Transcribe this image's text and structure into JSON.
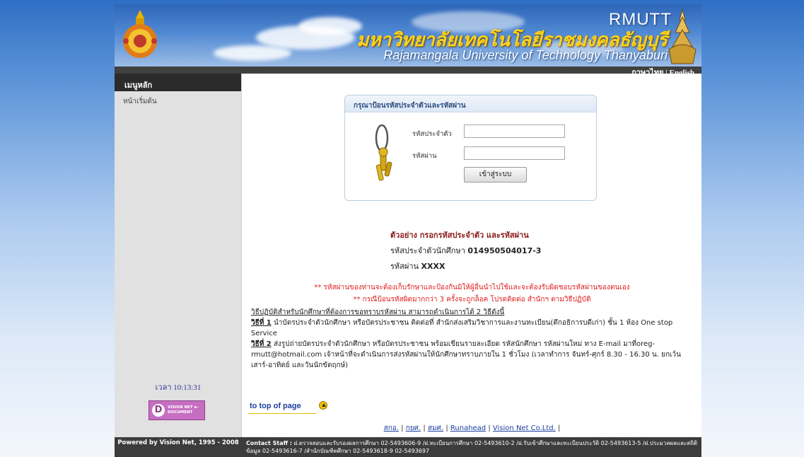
{
  "banner": {
    "brand": "RMUTT",
    "thai_name": "มหาวิทยาลัยเทคโนโลยีราชมงคลธัญบุรี",
    "english_name": "Rajamangala University of Technology Thanyaburi"
  },
  "language_links": {
    "thai": "ภาษาไทย",
    "separator": "|",
    "english": "English"
  },
  "sidebar": {
    "menu_header": "เมนูหลัก",
    "home_item": "หน้าเริ่มต้น",
    "clock": "เวลา 10:13:31",
    "vision_logo_text": "VISION NET e-DOCUMENT"
  },
  "login": {
    "title": "กรุณาป้อนรหัสประจำตัวและรหัสผ่าน",
    "id_label": "รหัสประจำตัว",
    "password_label": "รหัสผ่าน",
    "id_value": "",
    "password_value": "",
    "submit_label": "เข้าสู่ระบบ"
  },
  "example": {
    "title": "ตัวอย่าง กรอกรหัสประจำตัว และรหัสผ่าน",
    "id_prefix": "รหัสประจำตัวนักศึกษา",
    "id_value": "014950504017-3",
    "password_prefix": "รหัสผ่าน",
    "password_value": "XXXX"
  },
  "warnings": {
    "line1": "** รหัสผ่านของท่านจะต้องเก็บรักษาและป้องกันมิให้ผู้อื่นนำไปใช้และจะต้องรับผิดชอบรหัสผ่านของตนเอง",
    "line2": "** กรณีป้อนรหัสผิดมากกว่า 3 ครั้งจะถูกล็อค โปรดติดต่อ สำนักฯ ตามวิธีปฏิบัติ"
  },
  "howto": {
    "heading": "วิธีปฏิบัติสำหรับนักศึกษาที่ต้องการขอทราบรหัสผ่าน สามารถดำเนินการได้ 2 วิธีดังนี้",
    "method1_label": "วิธีที่ 1",
    "method1_text": "นำบัตรประจำตัวนักศึกษา หรือบัตรประชาชน ติดต่อที่ สำนักส่งเสริมวิชาการและงานทะเบียน(ตึกอธิการบดีเก่า) ชั้น 1 ห้อง One stop Service",
    "method2_label": "วิธีที่ 2",
    "method2_text": "ส่งรูปถ่ายบัตรประจำตัวนักศึกษา หรือบัตรประชาชน พร้อมเขียนรายละเอียด รหัสนักศึกษา รหัสผ่านใหม่ ทาง E-mail มาที่oreg-rmutt@hotmail.com เจ้าหน้าที่จะดำเนินการส่งรหัสผ่านให้นักศึกษาทราบภายใน 1 ชั่วโมง (เวลาทำการ จันทร์-ศุกร์ 8.30 - 16.30 น. ยกเว้นเสาร์-อาทิตย์ และวันนักขัตฤกษ์)"
  },
  "to_top": "to top of page",
  "footer_links": [
    "สกอ.",
    "กยศ.",
    "สมศ.",
    "Runahead",
    "Vision Net Co.Ltd."
  ],
  "footer_separator": "|",
  "bottom": {
    "powered": "Powered by Vision Net, 1995 - 2008",
    "contact_label": "Contact Staff :",
    "contact_text": "ฝ.ตรวจสอบและรับรองผลการศึกษา 02-5493606-9 /ฝ.ทะเบียนการศึกษา 02-5493610-2 /ฝ.รับเข้าศึกษาและทะเบียนประวัติ 02-5493613-5 /ฝ.ประมวลผลและสถิติข้อมูล 02-5493616-7 /สำนักบัณฑิตศึกษา 02-5493618-9 02-5493697"
  },
  "colors": {
    "banner_blue": "#2f66b8",
    "thai_name_gold": "#ffd21a",
    "sidebar_gray": "#e1e1e1",
    "dark_bar": "#3c3c3c",
    "warning_red": "#e02020",
    "example_title": "#8b1a1a"
  }
}
